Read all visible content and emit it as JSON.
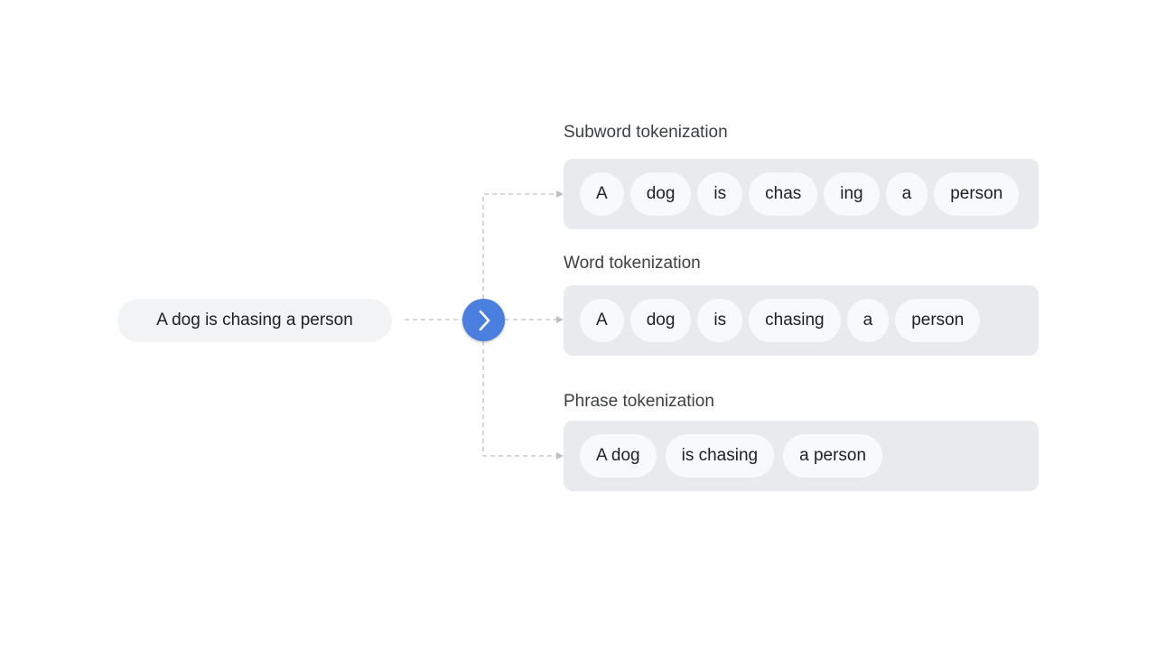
{
  "input": {
    "text": "A dog is chasing a person"
  },
  "colors": {
    "accent": "#4a7fe0",
    "panel": "#e8eaed",
    "token": "#f8f9fa",
    "connector": "#bdc1c6"
  },
  "icons": {
    "process": "chevron-right-icon"
  },
  "rows": [
    {
      "label": "Subword tokenization",
      "tokens": [
        "A",
        "dog",
        "is",
        "chas",
        "ing",
        "a",
        "person"
      ]
    },
    {
      "label": "Word tokenization",
      "tokens": [
        "A",
        "dog",
        "is",
        "chasing",
        "a",
        "person"
      ]
    },
    {
      "label": "Phrase tokenization",
      "tokens": [
        "A dog",
        "is chasing",
        "a person"
      ]
    }
  ]
}
